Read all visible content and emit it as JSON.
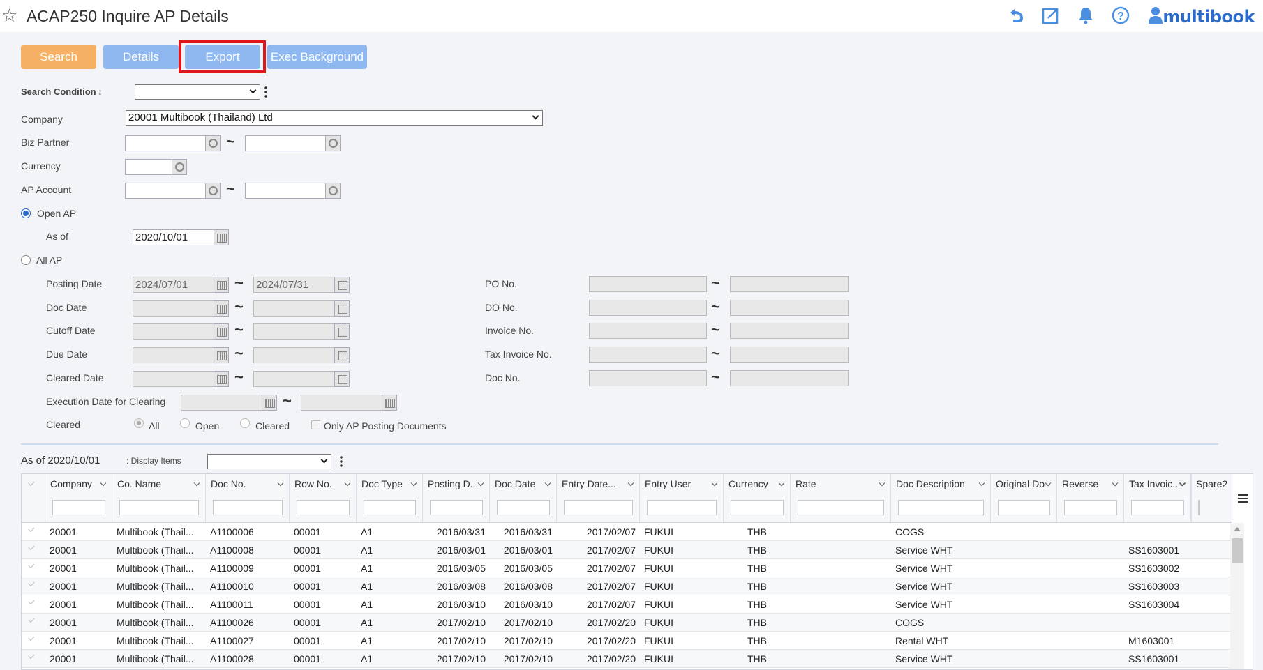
{
  "header": {
    "title": "ACAP250 Inquire AP Details",
    "brand": "multibook",
    "icons": [
      "undo-icon",
      "popout-icon",
      "bell-icon",
      "help-icon",
      "user-icon"
    ]
  },
  "toolbar": {
    "search": "Search",
    "details": "Details",
    "export": "Export",
    "exec_background": "Exec Background"
  },
  "form": {
    "search_condition_label": "Search Condition :",
    "search_condition_value": "",
    "company_label": "Company",
    "company_value": "20001 Multibook (Thailand) Ltd",
    "biz_partner_label": "Biz Partner",
    "currency_label": "Currency",
    "ap_account_label": "AP Account",
    "open_ap_label": "Open AP",
    "as_of_label": "As of",
    "as_of_value": "2020/10/01",
    "all_ap_label": "All AP",
    "posting_date_label": "Posting Date",
    "posting_date_from": "2024/07/01",
    "posting_date_to": "2024/07/31",
    "doc_date_label": "Doc Date",
    "cutoff_date_label": "Cutoff Date",
    "due_date_label": "Due Date",
    "cleared_date_label": "Cleared Date",
    "exec_date_clearing_label": "Execution Date for Clearing",
    "cleared_label": "Cleared",
    "cleared_opts": [
      "All",
      "Open",
      "Cleared"
    ],
    "only_ap_posting_label": "Only AP Posting Documents",
    "po_no_label": "PO No.",
    "do_no_label": "DO No.",
    "invoice_no_label": "Invoice No.",
    "tax_invoice_no_label": "Tax Invoice No.",
    "doc_no_label": "Doc No.",
    "tilde": "~"
  },
  "grid_bar": {
    "as_of_text": "As of 2020/10/01",
    "display_items_label": ": Display Items",
    "display_items_value": ""
  },
  "grid": {
    "columns": [
      "Company",
      "Co. Name",
      "Doc No.",
      "Row No.",
      "Doc Type",
      "Posting D...",
      "Doc Date",
      "Entry Date...",
      "Entry User",
      "Currency",
      "Rate",
      "Doc Description",
      "Original Doc ...",
      "Reverse",
      "Tax Invoic...",
      "Spare2"
    ],
    "rows": [
      [
        "20001",
        "Multibook (Thail...",
        "A1100006",
        "00001",
        "A1",
        "2016/03/31",
        "2016/03/31",
        "2017/02/07",
        "FUKUI",
        "THB",
        "",
        "COGS",
        "",
        "",
        "",
        ""
      ],
      [
        "20001",
        "Multibook (Thail...",
        "A1100008",
        "00001",
        "A1",
        "2016/03/01",
        "2016/03/01",
        "2017/02/07",
        "FUKUI",
        "THB",
        "",
        "Service WHT",
        "",
        "",
        "SS1603001",
        ""
      ],
      [
        "20001",
        "Multibook (Thail...",
        "A1100009",
        "00001",
        "A1",
        "2016/03/05",
        "2016/03/05",
        "2017/02/07",
        "FUKUI",
        "THB",
        "",
        "Service WHT",
        "",
        "",
        "SS1603002",
        ""
      ],
      [
        "20001",
        "Multibook (Thail...",
        "A1100010",
        "00001",
        "A1",
        "2016/03/08",
        "2016/03/08",
        "2017/02/07",
        "FUKUI",
        "THB",
        "",
        "Service WHT",
        "",
        "",
        "SS1603003",
        ""
      ],
      [
        "20001",
        "Multibook (Thail...",
        "A1100011",
        "00001",
        "A1",
        "2016/03/10",
        "2016/03/10",
        "2017/02/07",
        "FUKUI",
        "THB",
        "",
        "Service WHT",
        "",
        "",
        "SS1603004",
        ""
      ],
      [
        "20001",
        "Multibook (Thail...",
        "A1100026",
        "00001",
        "A1",
        "2017/02/10",
        "2017/02/10",
        "2017/02/20",
        "FUKUI",
        "THB",
        "",
        "COGS",
        "",
        "",
        "",
        ""
      ],
      [
        "20001",
        "Multibook (Thail...",
        "A1100027",
        "00001",
        "A1",
        "2017/02/10",
        "2017/02/10",
        "2017/02/20",
        "FUKUI",
        "THB",
        "",
        "Rental WHT",
        "",
        "",
        "M1603001",
        ""
      ],
      [
        "20001",
        "Multibook (Thail...",
        "A1100028",
        "00001",
        "A1",
        "2017/02/10",
        "2017/02/10",
        "2017/02/20",
        "FUKUI",
        "THB",
        "",
        "Service WHT",
        "",
        "",
        "SS1603001",
        ""
      ]
    ]
  }
}
